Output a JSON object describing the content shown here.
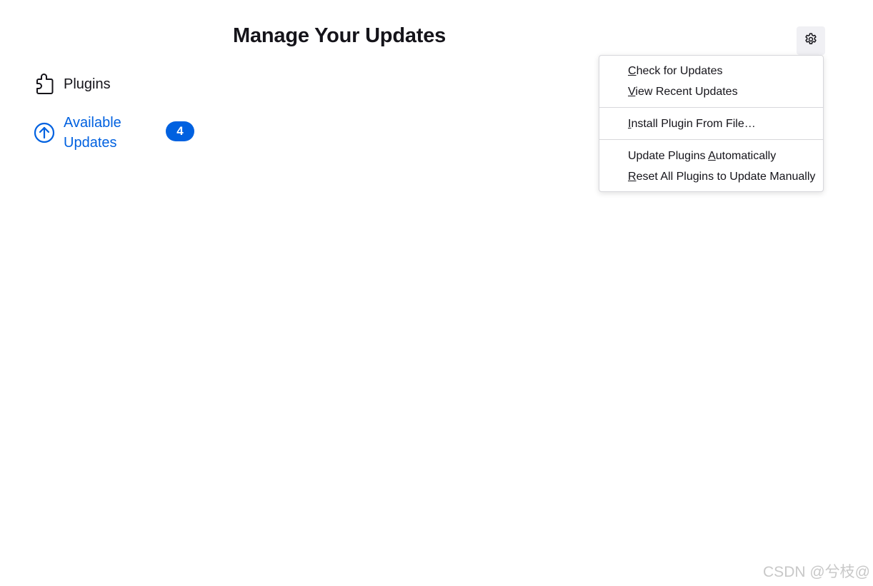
{
  "header": {
    "title": "Manage Your Updates"
  },
  "sidebar": {
    "items": [
      {
        "label": "Plugins",
        "icon": "puzzle-piece-icon",
        "selected": false
      },
      {
        "label": "Available Updates",
        "icon": "arrow-up-circle-icon",
        "selected": true,
        "badge": "4"
      }
    ]
  },
  "settings_button": {
    "icon": "gear-icon"
  },
  "menu": {
    "groups": [
      [
        {
          "pre": "",
          "u": "C",
          "post": "heck for Updates"
        },
        {
          "pre": "",
          "u": "V",
          "post": "iew Recent Updates"
        }
      ],
      [
        {
          "pre": "",
          "u": "I",
          "post": "nstall Plugin From File…"
        }
      ],
      [
        {
          "pre": "Update Plugins ",
          "u": "A",
          "post": "utomatically"
        },
        {
          "pre": "",
          "u": "R",
          "post": "eset All Plugins to Update Manually"
        }
      ]
    ]
  },
  "watermark": "CSDN @兮枝@",
  "colors": {
    "accent": "#0061e0",
    "text": "#15141a",
    "button_bg": "#f0f0f4"
  }
}
